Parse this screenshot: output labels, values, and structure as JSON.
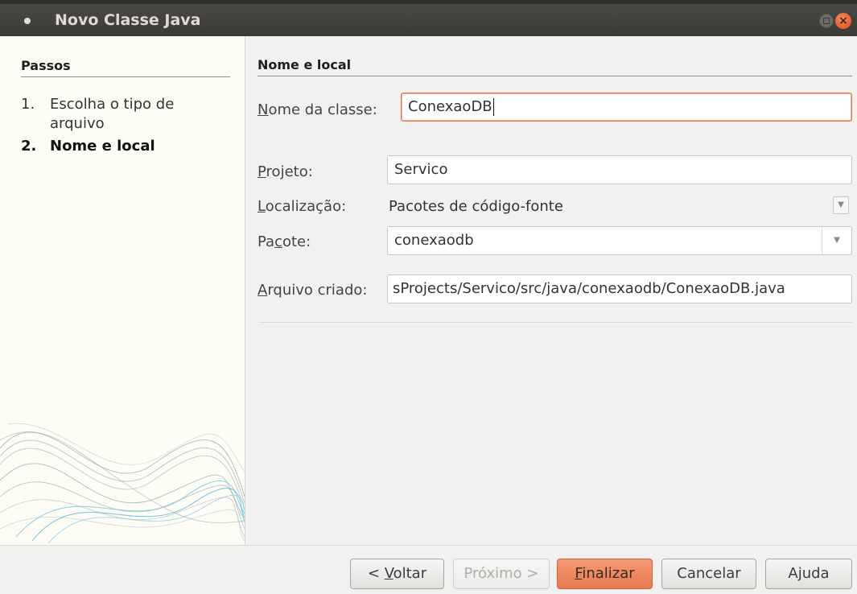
{
  "window": {
    "title": "Novo Classe Java"
  },
  "sidebar": {
    "title": "Passos",
    "steps": [
      {
        "num": "1.",
        "label_line1": "Escolha o tipo de",
        "label_line2": "arquivo"
      },
      {
        "num": "2.",
        "label": "Nome e local"
      }
    ]
  },
  "main": {
    "heading": "Nome e local",
    "class_name": {
      "label_pre": "",
      "label_ul": "N",
      "label_post": "ome da classe:",
      "value": "ConexaoDB"
    },
    "project": {
      "label_ul": "P",
      "label_post": "rojeto:",
      "value": "Servico"
    },
    "location": {
      "label_ul": "L",
      "label_post": "ocalização:",
      "value": "Pacotes de código-fonte"
    },
    "package": {
      "label_pre": "Pa",
      "label_ul": "c",
      "label_post": "ote:",
      "value": "conexaodb"
    },
    "created_file": {
      "label_ul": "A",
      "label_post": "rquivo criado:",
      "value": "sProjects/Servico/src/java/conexaodb/ConexaoDB.java"
    }
  },
  "buttons": {
    "back": {
      "pre": "< ",
      "ul": "V",
      "post": "oltar"
    },
    "next": "Próximo >",
    "finish": {
      "ul": "F",
      "post": "inalizar"
    },
    "cancel": "Cancelar",
    "help": "Ajuda"
  },
  "colors": {
    "accent": "#e9794e",
    "titlebar": "#3b3a36",
    "sidebar_bg": "#fefdf5",
    "focus_border": "#e8764a"
  },
  "icons": {
    "close": "close-icon",
    "maximize": "maximize-icon",
    "dropdown": "chevron-down-icon"
  }
}
